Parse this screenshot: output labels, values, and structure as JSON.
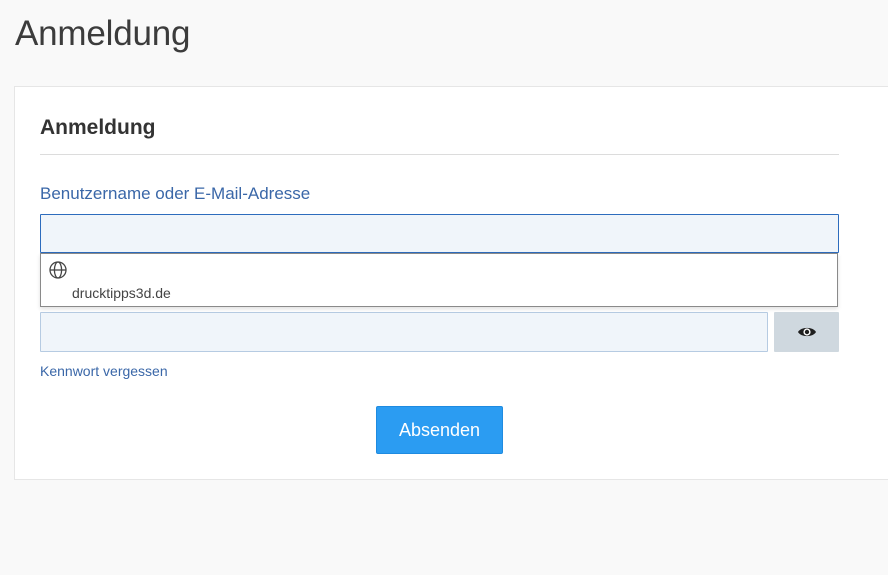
{
  "page": {
    "title": "Anmeldung"
  },
  "login_card": {
    "title": "Anmeldung",
    "username": {
      "label": "Benutzername oder E-Mail-Adresse",
      "value": ""
    },
    "autocomplete": {
      "icon": "globe-icon",
      "entry_text": "",
      "entry_domain": "drucktipps3d.de"
    },
    "password": {
      "value": "",
      "toggle_icon": "eye-icon"
    },
    "forgot_link": "Kennwort vergessen",
    "submit_label": "Absenden"
  },
  "colors": {
    "link": "#3a67a8",
    "input_bg": "#f0f5fa",
    "input_focus_border": "#2d6cbd",
    "submit_bg": "#2b9cf2",
    "toggle_bg": "#cfd8df"
  }
}
